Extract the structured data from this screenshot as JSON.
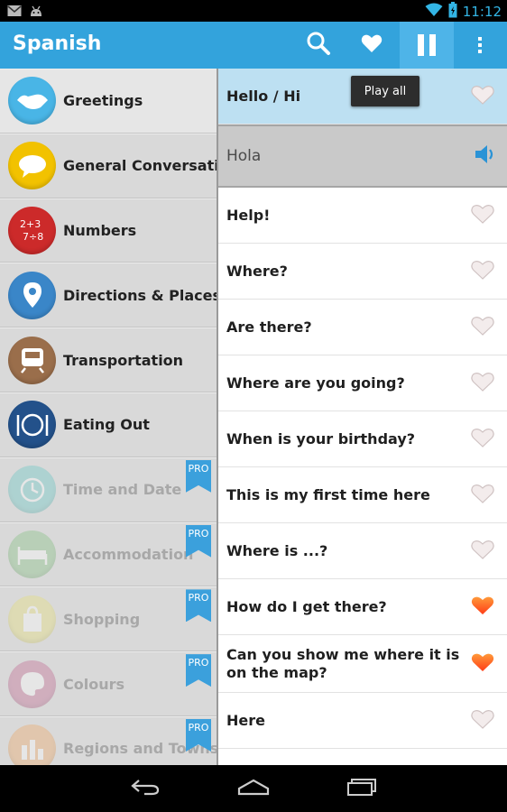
{
  "status": {
    "time": "11:12"
  },
  "app": {
    "title": "Spanish",
    "tooltip": "Play all"
  },
  "icons": {
    "search": "search-icon",
    "favorites": "heart-icon",
    "pause": "pause-icon",
    "overflow": "overflow-menu-icon",
    "back": "back-icon",
    "home": "home-icon",
    "recents": "recents-icon"
  },
  "colors": {
    "accent": "#33a3dc",
    "pro_badge": "#3ba0dc",
    "heart_active": "#ff5a1f",
    "heart_inactive": "#d9cfcf"
  },
  "categories": [
    {
      "label": "Greetings",
      "locked": false,
      "color": "#49b5e6"
    },
    {
      "label": "General Conversation",
      "locked": false,
      "color": "#f2c200"
    },
    {
      "label": "Numbers",
      "locked": false,
      "color": "#cc2a2a"
    },
    {
      "label": "Directions & Places",
      "locked": false,
      "color": "#3a86c8"
    },
    {
      "label": "Transportation",
      "locked": false,
      "color": "#9a6e4b"
    },
    {
      "label": "Eating Out",
      "locked": false,
      "color": "#23518a"
    },
    {
      "label": "Time and Date",
      "locked": true,
      "badge": "PRO",
      "color": "#5ec7c4"
    },
    {
      "label": "Accommodation",
      "locked": true,
      "badge": "PRO",
      "color": "#7dbf7a"
    },
    {
      "label": "Shopping",
      "locked": true,
      "badge": "PRO",
      "color": "#e8e070"
    },
    {
      "label": "Colours",
      "locked": true,
      "badge": "PRO",
      "color": "#c05f8c"
    },
    {
      "label": "Regions and Towns",
      "locked": true,
      "badge": "PRO",
      "color": "#f0a45c"
    }
  ],
  "phrases": [
    {
      "text": "Hello / Hi",
      "favorite": false
    },
    {
      "text": "Hola",
      "translation": true
    },
    {
      "text": "Help!",
      "favorite": false
    },
    {
      "text": "Where?",
      "favorite": false
    },
    {
      "text": "Are there?",
      "favorite": false
    },
    {
      "text": "Where are you going?",
      "favorite": false
    },
    {
      "text": "When is your birthday?",
      "favorite": false
    },
    {
      "text": "This is my first time here",
      "favorite": false
    },
    {
      "text": "Where is ...?",
      "favorite": false
    },
    {
      "text": "How do I get there?",
      "favorite": true
    },
    {
      "text": "Can you show me where it is on the map?",
      "favorite": true
    },
    {
      "text": "Here",
      "favorite": false
    }
  ]
}
